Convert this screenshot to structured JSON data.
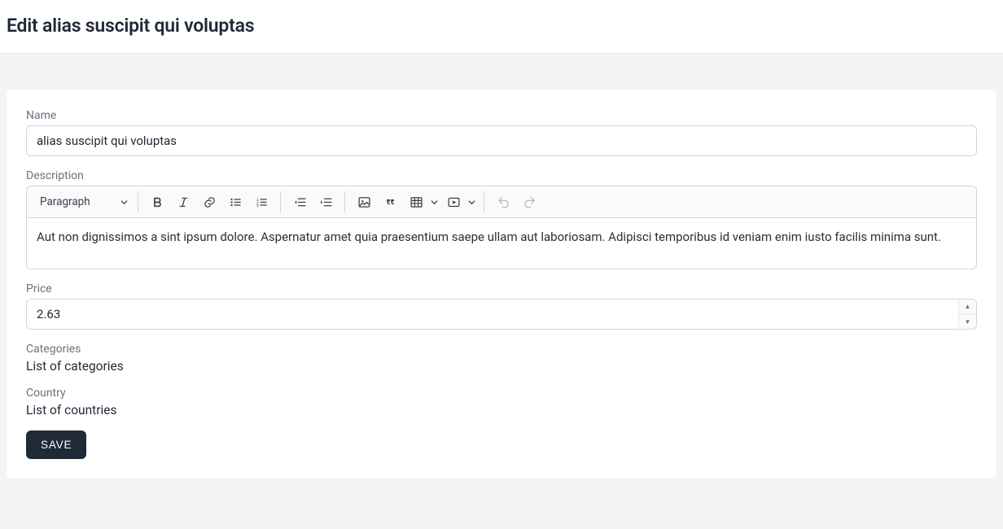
{
  "header": {
    "title": "Edit alias suscipit qui voluptas"
  },
  "form": {
    "name": {
      "label": "Name",
      "value": "alias suscipit qui voluptas"
    },
    "description": {
      "label": "Description",
      "heading_dropdown": "Paragraph",
      "body": "Aut non dignissimos a sint ipsum dolore. Aspernatur amet quia praesentium saepe ullam aut laboriosam. Adipisci temporibus id veniam enim iusto facilis minima sunt."
    },
    "price": {
      "label": "Price",
      "value": "2.63"
    },
    "categories": {
      "label": "Categories",
      "value": "List of categories"
    },
    "country": {
      "label": "Country",
      "value": "List of countries"
    },
    "save_label": "SAVE"
  }
}
